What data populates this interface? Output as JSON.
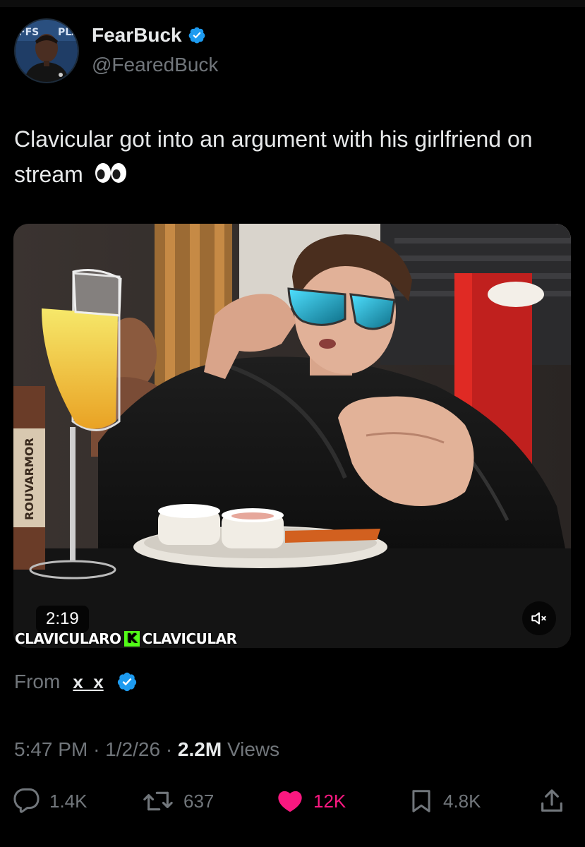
{
  "author": {
    "display_name": "FearBuck",
    "handle": "@FearedBuck",
    "verified": true
  },
  "tweet": {
    "text": "Clavicular got into an argument with his girlfriend on stream",
    "emoji": "👀"
  },
  "media": {
    "duration": "2:19",
    "watermark_left": "CLAVICULARO",
    "watermark_right": "CLAVICULAR",
    "kick_letter": "K",
    "muted": true,
    "mute_icon": "speaker-muted-icon"
  },
  "source": {
    "from_label": "From",
    "username": "x_x",
    "verified": true
  },
  "meta": {
    "time": "5:47 PM",
    "date": "1/2/26",
    "separator": "·",
    "views_count": "2.2M",
    "views_label": "Views"
  },
  "actions": {
    "replies": "1.4K",
    "reposts": "637",
    "likes": "12K",
    "bookmarks": "4.8K"
  },
  "colors": {
    "background": "#000000",
    "text": "#e7e9ea",
    "secondary": "#71767b",
    "verified_blue": "#1d9bf0",
    "like_pink": "#f91880"
  }
}
